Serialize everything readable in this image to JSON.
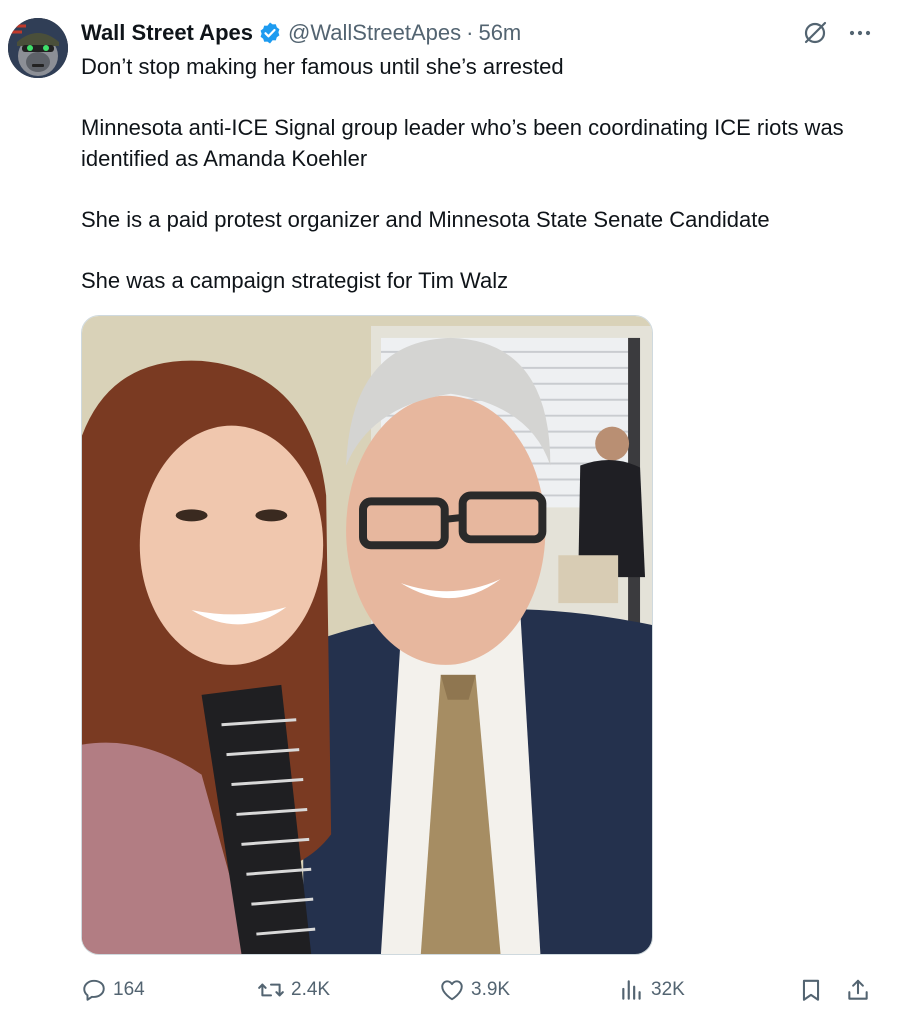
{
  "tweet": {
    "author": {
      "display_name": "Wall Street Apes",
      "handle": "@WallStreetApes",
      "verified": true,
      "avatar_icon": "gorilla-avatar-icon"
    },
    "separator": "·",
    "time": "56m",
    "text_lines": [
      "Don’t stop making her famous until she’s arrested",
      "Minnesota anti-ICE Signal group leader who’s been coordinating ICE riots was identified as Amanda Koehler",
      "She is a paid protest organizer and Minnesota State Senate Candidate",
      "She was a campaign strategist for Tim Walz"
    ],
    "stats": {
      "replies": "164",
      "reposts": "2.4K",
      "likes": "3.9K",
      "views": "32K"
    }
  },
  "colors": {
    "text_primary": "#0f1419",
    "text_secondary": "#536471",
    "verified_blue": "#1d9bf0",
    "border": "#cfd9de"
  },
  "icons": {
    "grok": "grok-icon",
    "more": "more-icon",
    "reply": "reply-icon",
    "repost": "repost-icon",
    "like": "like-icon",
    "views": "views-icon",
    "bookmark": "bookmark-icon",
    "share": "share-icon"
  }
}
